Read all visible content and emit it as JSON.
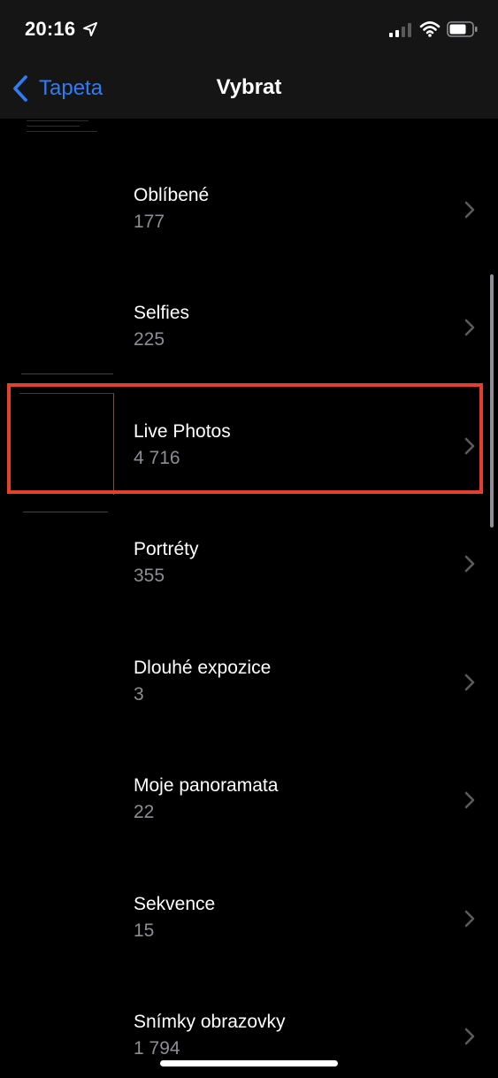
{
  "status_bar": {
    "time": "20:16",
    "icons": [
      "location-icon",
      "signal-icon",
      "wifi-icon",
      "battery-icon"
    ]
  },
  "nav": {
    "back_label": "Tapeta",
    "title": "Vybrat"
  },
  "albums": [
    {
      "title": "Oblíbené",
      "count": "177"
    },
    {
      "title": "Selfies",
      "count": "225"
    },
    {
      "title": "Live Photos",
      "count": "4 716"
    },
    {
      "title": "Portréty",
      "count": "355"
    },
    {
      "title": "Dlouhé expozice",
      "count": "3"
    },
    {
      "title": "Moje panoramata",
      "count": "22"
    },
    {
      "title": "Sekvence",
      "count": "15"
    },
    {
      "title": "Snímky obrazovky",
      "count": "1 794"
    }
  ],
  "colors": {
    "accent": "#2f7cf6",
    "highlight": "#e1422d",
    "secondary_text": "#8d8d93",
    "background": "#000000",
    "bar_background": "#151515"
  }
}
